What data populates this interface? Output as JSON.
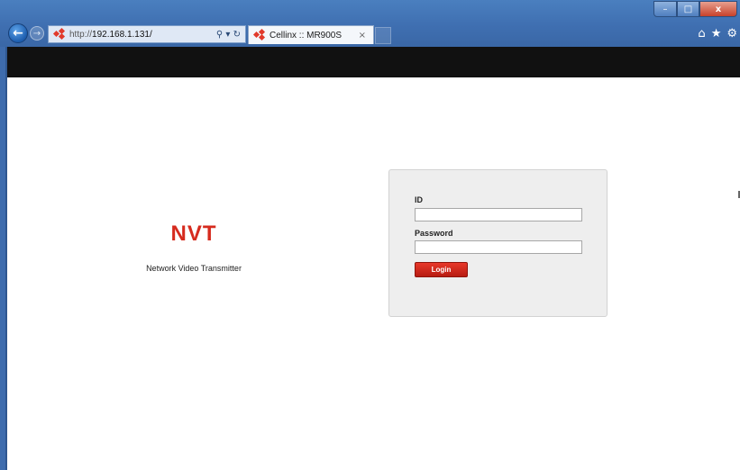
{
  "browser": {
    "url_prefix": "http://",
    "url_host": "192.168.1.131/",
    "address_tools": "⚲ ▾ ↻",
    "tab_title": "Cellinx :: MR900S",
    "tab_close": "×",
    "back_glyph": "←",
    "forward_glyph": "→",
    "window_controls": {
      "minimize": "–",
      "maximize": "□",
      "close": "x"
    },
    "toolbar_icons": {
      "home": "⌂",
      "favorites": "★",
      "tools": "⚙"
    }
  },
  "page": {
    "brand_title": "NVT",
    "brand_subtitle": "Network Video Transmitter",
    "login": {
      "id_label": "ID",
      "id_value": "",
      "password_label": "Password",
      "password_value": "",
      "button_label": "Login"
    }
  },
  "colors": {
    "brand_red": "#d62b1e",
    "titlebar_blue": "#3f6fb1",
    "page_topbar": "#111111",
    "panel_bg": "#eeeeee"
  }
}
